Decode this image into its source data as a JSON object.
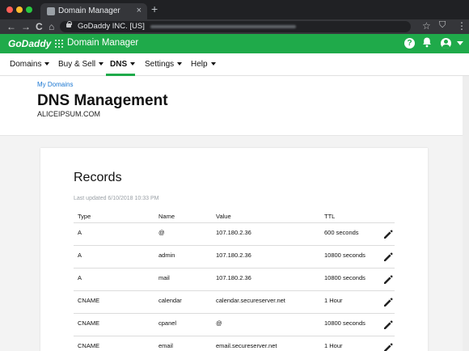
{
  "browser": {
    "tab_title": "Domain Manager",
    "tab_close": "×",
    "new_tab": "+",
    "address_org": "GoDaddy INC. [US]",
    "back": "←",
    "forward": "→",
    "reload": "C",
    "home": "⌂",
    "star": "☆",
    "menu": "⋮"
  },
  "header": {
    "logo": "GoDaddy",
    "app_name": "Domain Manager",
    "help": "?",
    "bell": "🔔"
  },
  "nav": {
    "items": [
      {
        "label": "Domains"
      },
      {
        "label": "Buy & Sell"
      },
      {
        "label": "DNS"
      },
      {
        "label": "Settings"
      },
      {
        "label": "Help"
      }
    ],
    "active": "DNS"
  },
  "page": {
    "breadcrumb": "My Domains",
    "title": "DNS Management",
    "domain": "ALICEIPSUM.COM"
  },
  "records": {
    "title": "Records",
    "last_updated": "Last updated 6/10/2018 10:33 PM",
    "columns": {
      "type": "Type",
      "name": "Name",
      "value": "Value",
      "ttl": "TTL"
    },
    "rows": [
      {
        "type": "A",
        "name": "@",
        "value": "107.180.2.36",
        "ttl": "600 seconds"
      },
      {
        "type": "A",
        "name": "admin",
        "value": "107.180.2.36",
        "ttl": "10800 seconds"
      },
      {
        "type": "A",
        "name": "mail",
        "value": "107.180.2.36",
        "ttl": "10800 seconds"
      },
      {
        "type": "CNAME",
        "name": "calendar",
        "value": "calendar.secureserver.net",
        "ttl": "1 Hour"
      },
      {
        "type": "CNAME",
        "name": "cpanel",
        "value": "@",
        "ttl": "10800 seconds"
      },
      {
        "type": "CNAME",
        "name": "email",
        "value": "email.secureserver.net",
        "ttl": "1 Hour"
      }
    ]
  },
  "colors": {
    "brand": "#1faa4a",
    "link": "#1976d2"
  }
}
